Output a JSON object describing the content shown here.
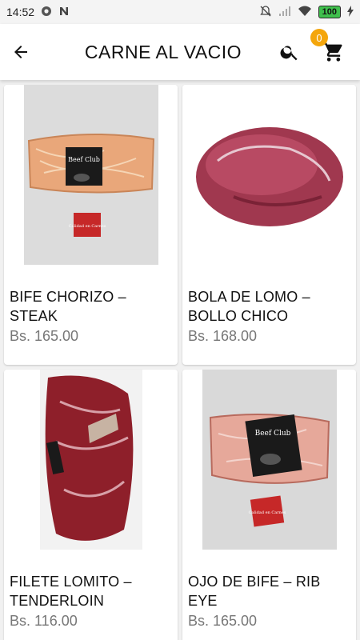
{
  "status": {
    "time": "14:52",
    "battery": "100"
  },
  "app_bar": {
    "title": "CARNE AL VACIO",
    "back_icon": "arrow-back-icon",
    "search_icon": "search-icon",
    "cart_icon": "cart-icon",
    "cart_count": "0"
  },
  "colors": {
    "accent": "#f4a60c",
    "price": "#777777"
  },
  "products": [
    {
      "name": "BIFE CHORIZO – STEAK",
      "price": "Bs. 165.00",
      "label_brand": "Beef Club",
      "label_stamp": "Calidad en Carnes"
    },
    {
      "name": "BOLA DE LOMO – BOLLO CHICO",
      "price": "Bs. 168.00"
    },
    {
      "name": "FILETE LOMITO – TENDERLOIN",
      "price": "Bs. 116.00"
    },
    {
      "name": "OJO DE BIFE – RIB EYE",
      "price": "Bs. 165.00",
      "label_brand": "Beef Club",
      "label_stamp": "Calidad en Carnes"
    }
  ]
}
